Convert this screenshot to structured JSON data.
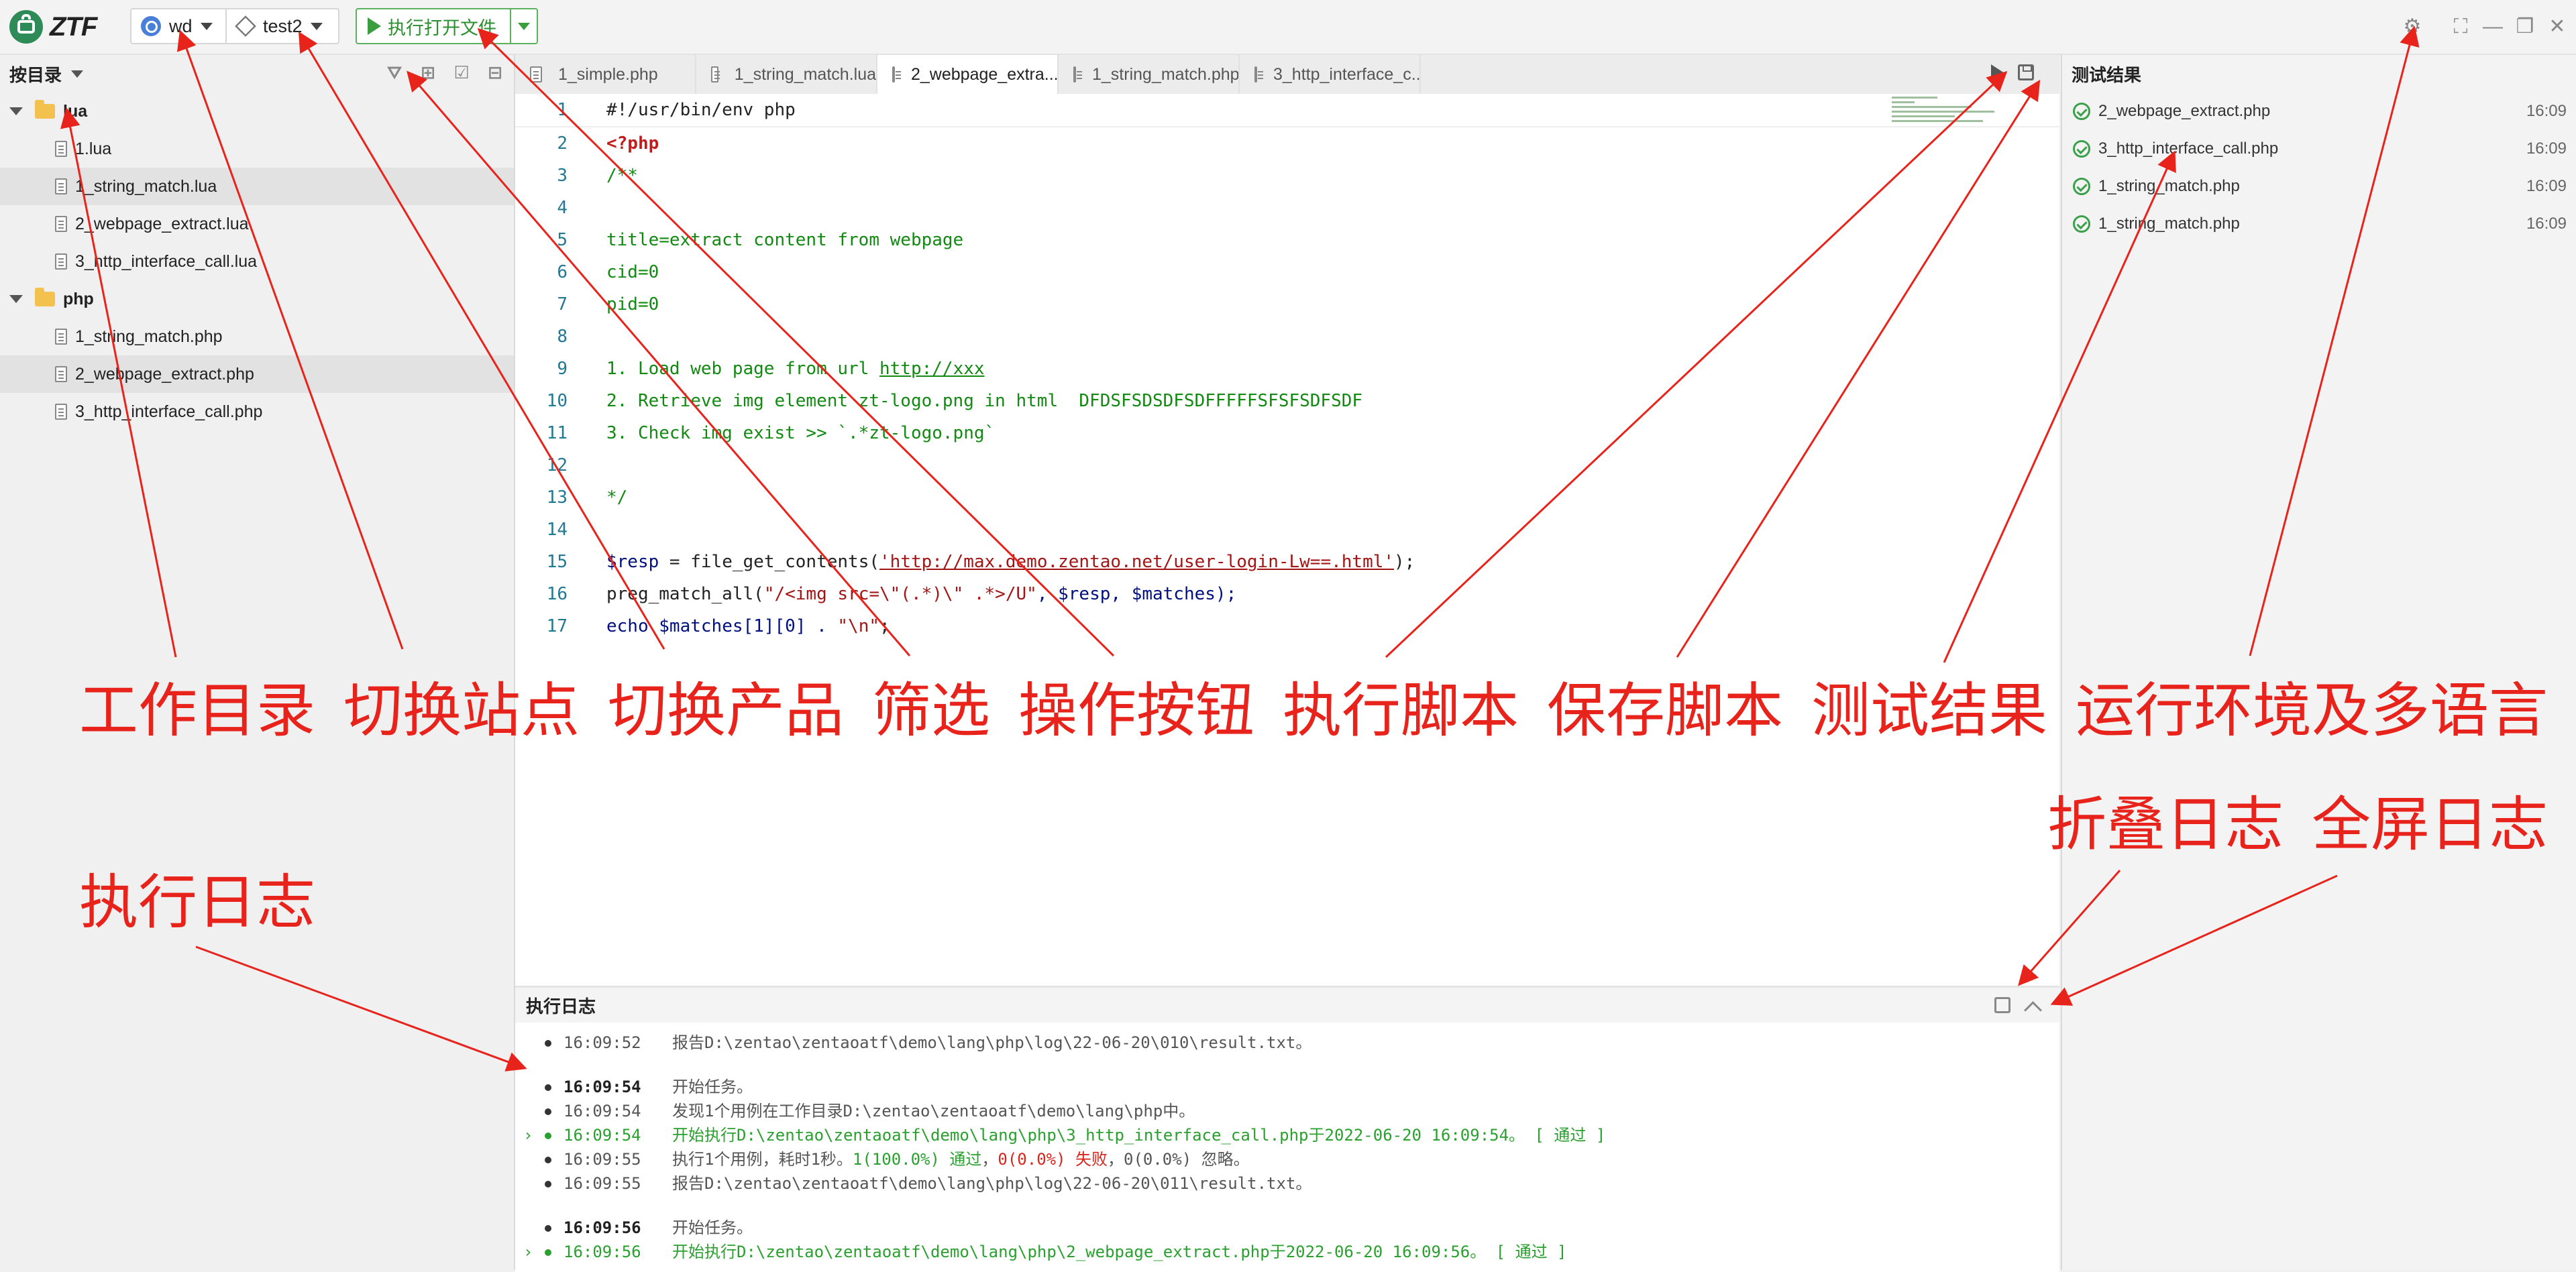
{
  "app": {
    "logo_text": "ZTF"
  },
  "toolbar": {
    "site": "wd",
    "product": "test2",
    "run_open_label": "执行打开文件"
  },
  "sidebar": {
    "header": "按目录",
    "tree": [
      {
        "type": "folder",
        "label": "lua"
      },
      {
        "type": "file",
        "label": "1.lua"
      },
      {
        "type": "file",
        "label": "1_string_match.lua",
        "selected": true
      },
      {
        "type": "file",
        "label": "2_webpage_extract.lua"
      },
      {
        "type": "file",
        "label": "3_http_interface_call.lua"
      },
      {
        "type": "folder",
        "label": "php"
      },
      {
        "type": "file",
        "label": "1_string_match.php"
      },
      {
        "type": "file",
        "label": "2_webpage_extract.php",
        "selected": true
      },
      {
        "type": "file",
        "label": "3_http_interface_call.php"
      }
    ]
  },
  "tabs": [
    {
      "label": "1_simple.php"
    },
    {
      "label": "1_string_match.lua"
    },
    {
      "label": "2_webpage_extra...",
      "active": true
    },
    {
      "label": "1_string_match.php"
    },
    {
      "label": "3_http_interface_c..."
    }
  ],
  "code": [
    {
      "n": "1",
      "t": "#!/usr/bin/env php"
    },
    {
      "n": "2",
      "t": "<?php"
    },
    {
      "n": "3",
      "t": "/**"
    },
    {
      "n": "4",
      "t": ""
    },
    {
      "n": "5",
      "t": "title=extract content from webpage"
    },
    {
      "n": "6",
      "t": "cid=0"
    },
    {
      "n": "7",
      "t": "pid=0"
    },
    {
      "n": "8",
      "t": ""
    },
    {
      "n": "9",
      "t": "1. Load web page from url ",
      "link": "http://xxx"
    },
    {
      "n": "10",
      "t": "2. Retrieve img element zt-logo.png in html  DFDSFSDSDFSDFFFFFSFSFSDFSDF"
    },
    {
      "n": "11",
      "t": "3. Check img exist >> `.*zt-logo.png`"
    },
    {
      "n": "12",
      "t": ""
    },
    {
      "n": "13",
      "t": "*/"
    },
    {
      "n": "14",
      "t": ""
    },
    {
      "n": "15",
      "a": "$resp",
      "b": " = file_get_contents(",
      "c": "'http://max.demo.zentao.net/user-login-Lw==.html'",
      "d": ");"
    },
    {
      "n": "16",
      "a": "preg_match_all(",
      "b": "\"/<img src=\\\"(.*)\\\" .*>/U\"",
      "c": ", $resp, $matches);"
    },
    {
      "n": "17",
      "a": "echo",
      "b": " $matches[1][0] . ",
      "c": "\"\\n\"",
      "d": ";"
    }
  ],
  "log": {
    "title": "执行日志",
    "lines": [
      {
        "time": "16:09:52",
        "msg": "报告D:\\zentao\\zentaoatf\\demo\\lang\\php\\log\\22-06-20\\010\\result.txt。"
      },
      {
        "time": "16:09:54",
        "msg": "开始任务。",
        "bold": true,
        "gap": true
      },
      {
        "time": "16:09:54",
        "msg": "发现1个用例在工作目录D:\\zentao\\zentaoatf\\demo\\lang\\php中。"
      },
      {
        "time": "16:09:54",
        "msg": "开始执行D:\\zentao\\zentaoatf\\demo\\lang\\php\\3_http_interface_call.php于2022-06-20 16:09:54。 [ 通过 ]",
        "green": true,
        "arrow": true
      },
      {
        "time": "16:09:55",
        "summary": true,
        "p1": "执行1个用例，耗时1秒。",
        "pass": "1(100.0%) 通过",
        "sep": "，",
        "fail": "0(0.0%) 失败",
        "p2": "，0(0.0%) 忽略。"
      },
      {
        "time": "16:09:55",
        "msg": "报告D:\\zentao\\zentaoatf\\demo\\lang\\php\\log\\22-06-20\\011\\result.txt。"
      },
      {
        "time": "16:09:56",
        "msg": "开始任务。",
        "bold": true,
        "gap": true
      },
      {
        "time": "16:09:56",
        "msg": "开始执行D:\\zentao\\zentaoatf\\demo\\lang\\php\\2_webpage_extract.php于2022-06-20 16:09:56。 [ 通过 ]",
        "green": true,
        "arrow": true
      }
    ]
  },
  "results": {
    "title": "测试结果",
    "items": [
      {
        "name": "2_webpage_extract.php",
        "time": "16:09"
      },
      {
        "name": "3_http_interface_call.php",
        "time": "16:09"
      },
      {
        "name": "1_string_match.php",
        "time": "16:09"
      },
      {
        "name": "1_string_match.php",
        "time": "16:09"
      }
    ]
  },
  "annotations": {
    "work_dir": "工作目录",
    "switch_site": "切换站点",
    "switch_product": "切换产品",
    "filter": "筛选",
    "action_buttons": "操作按钮",
    "run_script": "执行脚本",
    "save_script": "保存脚本",
    "test_results": "测试结果",
    "env_lang": "运行环境及多语言",
    "collapse_log": "折叠日志",
    "fullscreen_log": "全屏日志",
    "exec_log": "执行日志"
  },
  "colors": {
    "annotation": "#e8231b",
    "pass": "#2aa02f",
    "fail": "#d9261c"
  }
}
